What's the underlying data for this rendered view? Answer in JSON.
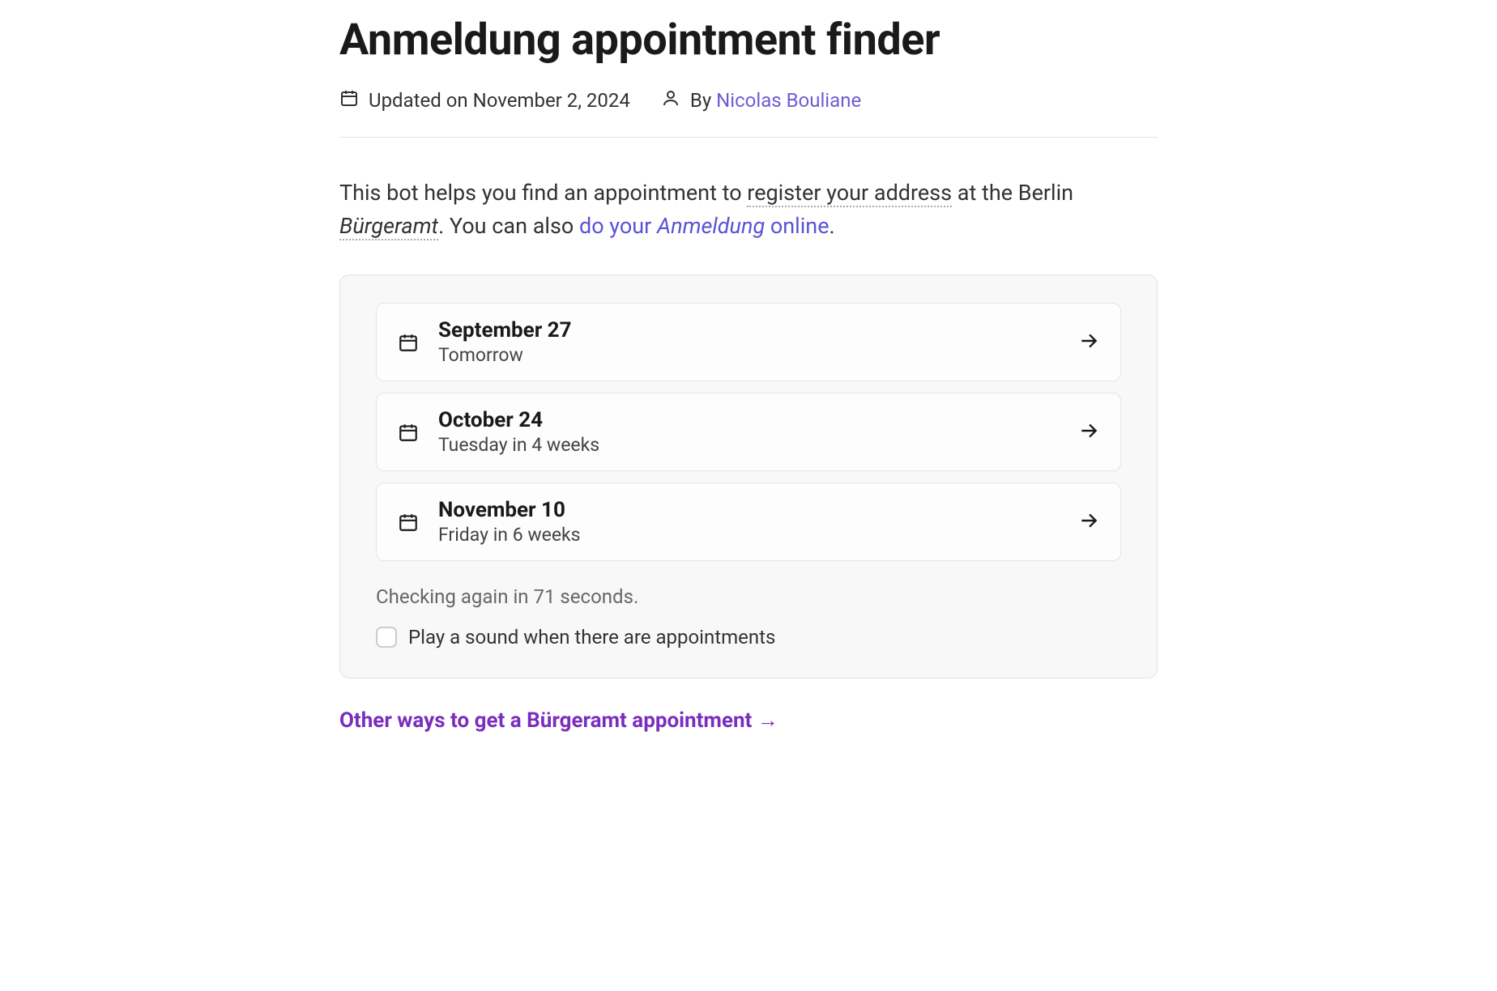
{
  "title": "Anmeldung appointment finder",
  "meta": {
    "updated_prefix": "Updated on ",
    "updated_date": "November 2, 2024",
    "by_prefix": "By ",
    "author": "Nicolas Bouliane"
  },
  "intro": {
    "part1": "This bot helps you find an appointment to ",
    "register": "register your address",
    "part2": " at the Berlin ",
    "burgeramt": "Bürgeramt",
    "part3": ". You can also ",
    "link_pre": "do your ",
    "link_italic": "Anmeldung",
    "link_post": " online",
    "part4": "."
  },
  "slots": [
    {
      "date": "September 27",
      "relative": "Tomorrow"
    },
    {
      "date": "October 24",
      "relative": "Tuesday in 4 weeks"
    },
    {
      "date": "November 10",
      "relative": "Friday in 6 weeks"
    }
  ],
  "status": "Checking again in 71 seconds.",
  "sound_label": "Play a sound when there are appointments",
  "other_ways": "Other ways to get a Bürgeramt appointment →"
}
